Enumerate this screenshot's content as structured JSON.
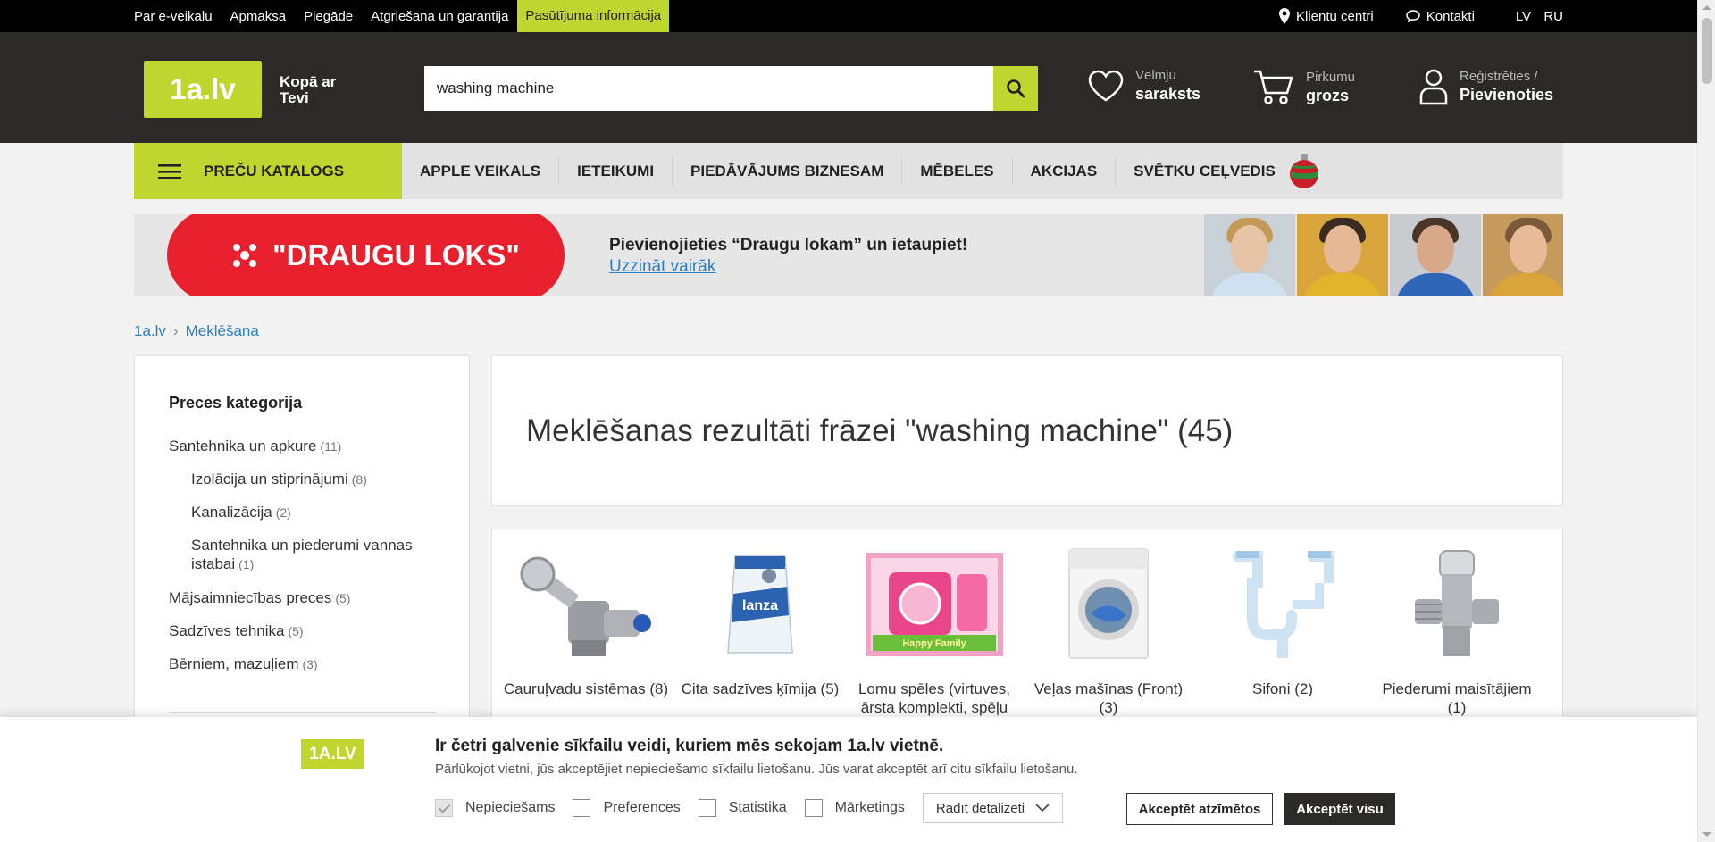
{
  "topbar": {
    "links": [
      "Par e-veikalu",
      "Apmaksa",
      "Piegāde",
      "Atgriešana un garantija"
    ],
    "highlight": "Pasūtījuma informācija",
    "clients": "Klientu centri",
    "contacts": "Kontakti",
    "lang_lv": "LV",
    "lang_ru": "RU"
  },
  "header": {
    "logo": "1a.lv",
    "tagline_line1": "Kopā ar",
    "tagline_line2": "Tevi",
    "search_value": "washing machine",
    "wishlist_1": "Vēlmju",
    "wishlist_2": "saraksts",
    "cart_1": "Pirkumu",
    "cart_2": "grozs",
    "account_1": "Reģistrēties /",
    "account_2": "Pievienoties",
    "accent": "#bfd62f"
  },
  "nav": {
    "catalog": "PREČU KATALOGS",
    "items": [
      "APPLE VEIKALS",
      "IETEIKUMI",
      "PIEDĀVĀJUMS BIZNESAM",
      "MĒBELES",
      "AKCIJAS",
      "SVĒTKU CEĻVEDIS"
    ]
  },
  "promo": {
    "title": "\"DRAUGU LOKS\"",
    "message": "Pievienojieties “Draugu lokam” un ietaupiet!",
    "link": "Uzzināt vairāk"
  },
  "breadcrumb": {
    "home": "1a.lv",
    "current": "Meklēšana"
  },
  "sidebar": {
    "heading": "Preces kategorija",
    "categories": [
      {
        "label": "Santehnika un apkure",
        "count": "(11)"
      },
      {
        "label": "Izolācija un stiprinājumi",
        "count": "(8)"
      },
      {
        "label": "Kanalizācija",
        "count": "(2)"
      },
      {
        "label": "Santehnika un piederumi vannas istabai",
        "count": "(1)"
      },
      {
        "label": "Mājsaimniecības preces",
        "count": "(5)"
      },
      {
        "label": "Sadzīves tehnika",
        "count": "(5)"
      },
      {
        "label": "Bērniem, mazuļiem",
        "count": "(3)"
      }
    ]
  },
  "results": {
    "heading": "Meklēšanas rezultāti frāzei \"washing machine\" (45)"
  },
  "product_categories": [
    {
      "label": "Cauruļvadu sistēmas (8)"
    },
    {
      "label": "Cita sadzīves ķīmija (5)"
    },
    {
      "label": "Lomu spēles (virtuves, ārsta komplekti, spēļu"
    },
    {
      "label": "Veļas mašīnas (Front) (3)"
    },
    {
      "label": "Sifoni (2)"
    },
    {
      "label": "Piederumi maisītājiem (1)"
    }
  ],
  "cookie": {
    "logo": "1A.LV",
    "title": "Ir četri galvenie sīkfailu veidi, kuriem mēs sekojam 1a.lv vietnē.",
    "description": "Pārlūkojot vietni, jūs akceptējiet nepieciešamo sīkfailu lietošanu. Jūs varat akceptēt arī citu sīkfailu lietošanu.",
    "opt_necessary": "Nepieciešams",
    "opt_preferences": "Preferences",
    "opt_statistics": "Statistika",
    "opt_marketing": "Mārketings",
    "details": "Rādīt detalizēti",
    "accept_selected": "Akceptēt atzīmētos",
    "accept_all": "Akceptēt visu"
  }
}
